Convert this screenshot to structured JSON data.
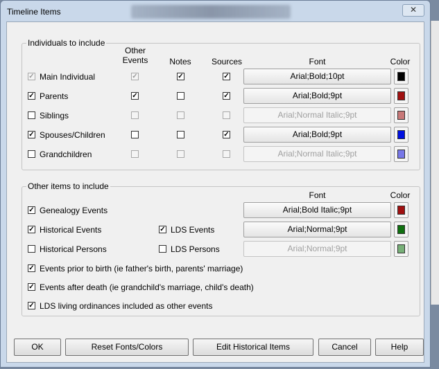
{
  "window": {
    "title": "Timeline Items",
    "close_glyph": "✕"
  },
  "individuals": {
    "group_label": "Individuals to include",
    "headers": {
      "other_events": "Other Events",
      "notes": "Notes",
      "sources": "Sources",
      "font": "Font",
      "color": "Color"
    },
    "rows": [
      {
        "label": "Main Individual",
        "include": true,
        "include_enabled": false,
        "other_events": true,
        "other_enabled": false,
        "notes": true,
        "notes_enabled": true,
        "sources": true,
        "sources_enabled": true,
        "font": "Arial;Bold;10pt",
        "font_enabled": true,
        "color": "#000000"
      },
      {
        "label": "Parents",
        "include": true,
        "include_enabled": true,
        "other_events": true,
        "other_enabled": true,
        "notes": false,
        "notes_enabled": true,
        "sources": true,
        "sources_enabled": true,
        "font": "Arial;Bold;9pt",
        "font_enabled": true,
        "color": "#a01010"
      },
      {
        "label": "Siblings",
        "include": false,
        "include_enabled": true,
        "other_events": false,
        "other_enabled": false,
        "notes": false,
        "notes_enabled": false,
        "sources": false,
        "sources_enabled": false,
        "font": "Arial;Normal Italic;9pt",
        "font_enabled": false,
        "color": "#c87878"
      },
      {
        "label": "Spouses/Children",
        "include": true,
        "include_enabled": true,
        "other_events": false,
        "other_enabled": true,
        "notes": false,
        "notes_enabled": true,
        "sources": true,
        "sources_enabled": true,
        "font": "Arial;Bold;9pt",
        "font_enabled": true,
        "color": "#0010e0"
      },
      {
        "label": "Grandchildren",
        "include": false,
        "include_enabled": true,
        "other_events": false,
        "other_enabled": false,
        "notes": false,
        "notes_enabled": false,
        "sources": false,
        "sources_enabled": false,
        "font": "Arial;Normal Italic;9pt",
        "font_enabled": false,
        "color": "#7878e8"
      }
    ]
  },
  "other_items": {
    "group_label": "Other items to include",
    "headers": {
      "font": "Font",
      "color": "Color"
    },
    "genealogy": {
      "label": "Genealogy Events",
      "checked": true,
      "font": "Arial;Bold Italic;9pt",
      "font_enabled": true,
      "color": "#a01010"
    },
    "historical_events": {
      "label": "Historical Events",
      "checked": true
    },
    "lds_events": {
      "label": "LDS Events",
      "checked": true,
      "font": "Arial;Normal;9pt",
      "font_enabled": true,
      "color": "#107010"
    },
    "historical_persons": {
      "label": "Historical Persons",
      "checked": false
    },
    "lds_persons": {
      "label": "LDS Persons",
      "checked": false,
      "font": "Arial;Normal;9pt",
      "font_enabled": false,
      "color": "#78b078"
    },
    "prior_birth": {
      "label": "Events prior to birth (ie father's birth, parents' marriage)",
      "checked": true
    },
    "after_death": {
      "label": "Events after death (ie grandchild's marriage, child's death)",
      "checked": true
    },
    "lds_living": {
      "label": "LDS living ordinances included as other events",
      "checked": true
    }
  },
  "buttons": {
    "ok": "OK",
    "reset": "Reset Fonts/Colors",
    "edit": "Edit Historical Items",
    "cancel": "Cancel",
    "help": "Help"
  }
}
